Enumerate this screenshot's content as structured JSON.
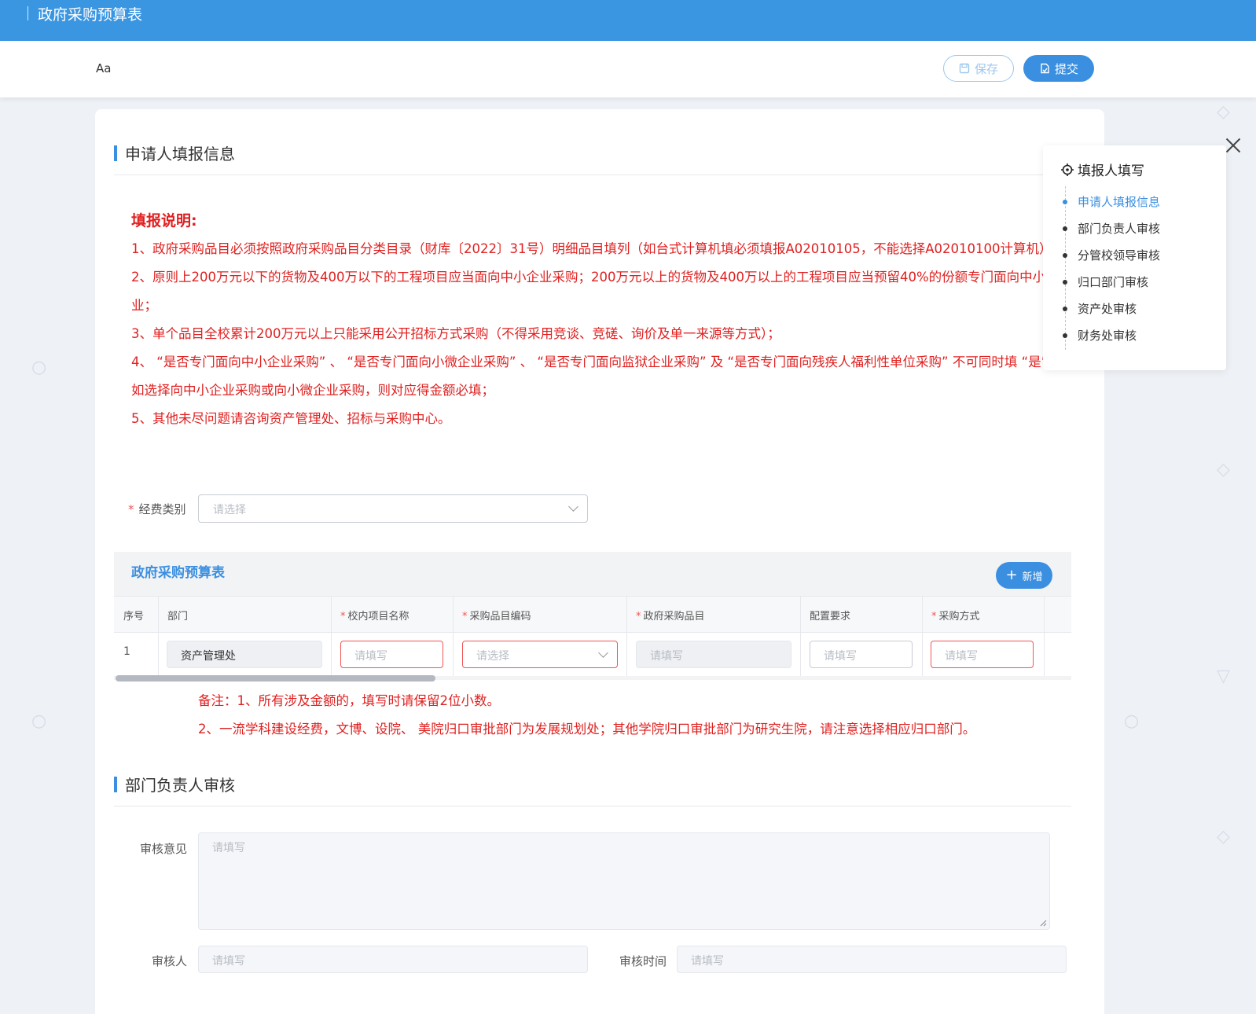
{
  "app": {
    "title": "政府采购预算表"
  },
  "toolbar": {
    "font_toggle": "Aa",
    "save_label": "保存",
    "submit_label": "提交"
  },
  "section1": {
    "title": "申请人填报信息",
    "notes_title": "填报说明:",
    "notes": [
      "1、政府采购品目必须按照政府采购品目分类目录（财库〔2022〕31号）明细品目填列（如台式计算机填必须填报A02010105，不能选择A02010100计算机）；",
      "2、原则上200万元以下的货物及400万以下的工程项目应当面向中小企业采购；200万元以上的货物及400万以上的工程项目应当预留40%的份额专门面向中小企业；",
      "3、单个品目全校累计200万元以上只能采用公开招标方式采购（不得采用竞谈、竞磋、询价及单一来源等方式）；",
      " 4、 “是否专门面向中小企业采购” 、 “是否专门面向小微企业采购” 、 “是否专门面向监狱企业采购” 及 “是否专门面向残疾人福利性单位采购” 不可同时填 “是” ，如选择向中小企业采购或向小微企业采购，则对应得金额必填；",
      "5、其他未尽问题请咨询资产管理处、招标与采购中心。"
    ],
    "fund_type": {
      "label": "经费类别",
      "placeholder": "请选择"
    }
  },
  "table": {
    "title": "政府采购预算表",
    "add_label": "新增",
    "columns": [
      {
        "label": "序号",
        "required": false
      },
      {
        "label": "部门",
        "required": false
      },
      {
        "label": "校内项目名称",
        "required": true
      },
      {
        "label": "采购品目编码",
        "required": true
      },
      {
        "label": "政府采购品目",
        "required": true
      },
      {
        "label": "配置要求",
        "required": false
      },
      {
        "label": "采购方式",
        "required": true
      }
    ],
    "row": {
      "index": "1",
      "department": "资产管理处",
      "project_name_ph": "请填写",
      "item_code_ph": "请选择",
      "gov_item_ph": "请填写",
      "config_ph": "请填写",
      "method_ph": "请填写"
    }
  },
  "remarks": [
    "备注：1、所有涉及金额的，填写时请保留2位小数。",
    "2、一流学科建设经费，文博、设院、 美院归口审批部门为发展规划处；其他学院归口审批部门为研究生院，请注意选择相应归口部门。"
  ],
  "section2": {
    "title": "部门负责人审核",
    "opinion_label": "审核意见",
    "opinion_ph": "请填写",
    "reviewer_label": "审核人",
    "reviewer_ph": "请填写",
    "review_time_label": "审核时间",
    "review_time_ph": "请填写"
  },
  "sidenav": {
    "title": "填报人填写",
    "items": [
      "申请人填报信息",
      "部门负责人审核",
      "分管校领导审核",
      "归口部门审核",
      "资产处审核",
      "财务处审核"
    ],
    "active_index": 0
  },
  "colors": {
    "primary": "#3b8fe0",
    "topbar": "#3b96e2",
    "error": "#e02020"
  }
}
